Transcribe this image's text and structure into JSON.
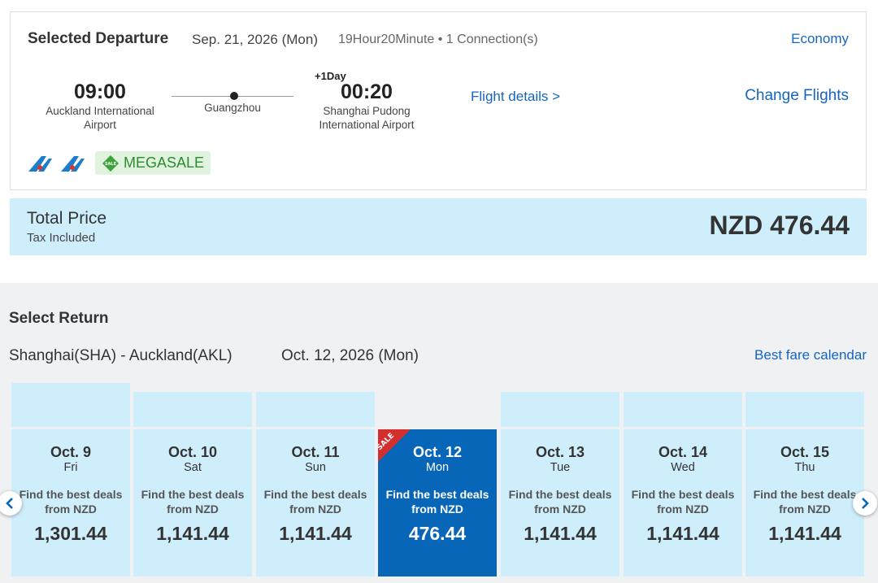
{
  "departure": {
    "title": "Selected Departure",
    "date": "Sep. 21, 2026 (Mon)",
    "duration": "19Hour20Minute",
    "connections": "1 Connection(s)",
    "cabin": "Economy",
    "depart_time": "09:00",
    "depart_airport": "Auckland International Airport",
    "stop_city": "Guangzhou",
    "plus_day": "+1Day",
    "arrive_time": "00:20",
    "arrive_airport": "Shanghai Pudong International Airport",
    "flight_details": "Flight details >",
    "change_flights": "Change Flights",
    "promo_label": "MEGASALE",
    "promo_tag_text": "SALE",
    "airline_logo_icon": "china-southern-logo-icon",
    "airline_color": "#1c7ec9",
    "promo_color": "#2e8b2e"
  },
  "total": {
    "title": "Total Price",
    "subtitle": "Tax Included",
    "amount": "NZD 476.44"
  },
  "return": {
    "title": "Select Return",
    "route": "Shanghai(SHA) - Auckland(AKL)",
    "date": "Oct. 12, 2026 (Mon)",
    "calendar_link": "Best fare calendar",
    "sale_ribbon": "SALE",
    "days": [
      {
        "date": "Oct. 9",
        "dow": "Fri",
        "deal": "Find the best deals",
        "from": "from NZD",
        "price": "1,301.44"
      },
      {
        "date": "Oct. 10",
        "dow": "Sat",
        "deal": "Find the best deals",
        "from": "from NZD",
        "price": "1,141.44"
      },
      {
        "date": "Oct. 11",
        "dow": "Sun",
        "deal": "Find the best deals",
        "from": "from NZD",
        "price": "1,141.44"
      },
      {
        "date": "Oct. 12",
        "dow": "Mon",
        "deal": "Find the best deals",
        "from": "from NZD",
        "price": "476.44"
      },
      {
        "date": "Oct. 13",
        "dow": "Tue",
        "deal": "Find the best deals",
        "from": "from NZD",
        "price": "1,141.44"
      },
      {
        "date": "Oct. 14",
        "dow": "Wed",
        "deal": "Find the best deals",
        "from": "from NZD",
        "price": "1,141.44"
      },
      {
        "date": "Oct. 15",
        "dow": "Thu",
        "deal": "Find the best deals",
        "from": "from NZD",
        "price": "1,141.44"
      }
    ],
    "selected_index": 3,
    "colors": {
      "selected": "#0866b8",
      "unselected": "#cfeefc",
      "link": "#1565c0",
      "sale_ribbon": "#d32f2f"
    }
  }
}
